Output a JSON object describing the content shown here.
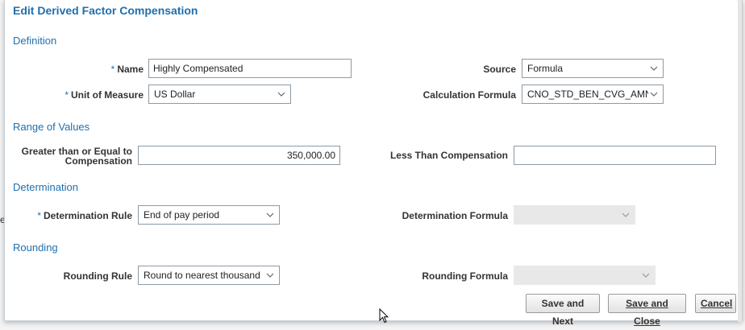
{
  "background": {
    "text": "e"
  },
  "dialog": {
    "title": "Edit Derived Factor Compensation"
  },
  "definition": {
    "heading": "Definition",
    "name": {
      "label": "Name",
      "value": "Highly Compensated",
      "required": "*"
    },
    "unit_of_measure": {
      "label": "Unit of Measure",
      "value": "US Dollar",
      "required": "*"
    },
    "source": {
      "label": "Source",
      "value": "Formula"
    },
    "calculation_formula": {
      "label": "Calculation Formula",
      "value": "CNO_STD_BEN_CVG_AMNT"
    }
  },
  "range_of_values": {
    "heading": "Range of Values",
    "greater_than_line1": "Greater than or Equal to",
    "greater_than_line2": "Compensation",
    "greater_than_value": "350,000.00",
    "less_than_label": "Less Than Compensation",
    "less_than_value": ""
  },
  "determination": {
    "heading": "Determination",
    "rule": {
      "label": "Determination Rule",
      "value": "End of pay period",
      "required": "*"
    },
    "formula": {
      "label": "Determination Formula",
      "value": ""
    }
  },
  "rounding": {
    "heading": "Rounding",
    "rule": {
      "label": "Rounding Rule",
      "value": "Round to nearest thousand"
    },
    "formula": {
      "label": "Rounding Formula",
      "value": ""
    }
  },
  "buttons": {
    "save_and_next": "Save and Next",
    "save_and_close": "Save and Close",
    "cancel": "Cancel"
  },
  "colors": {
    "accent": "#1f6fae",
    "disabled": "#e8e8e8"
  },
  "icons": {
    "dropdown": "chevron-down-icon",
    "pointer": "mouse-pointer-icon"
  }
}
